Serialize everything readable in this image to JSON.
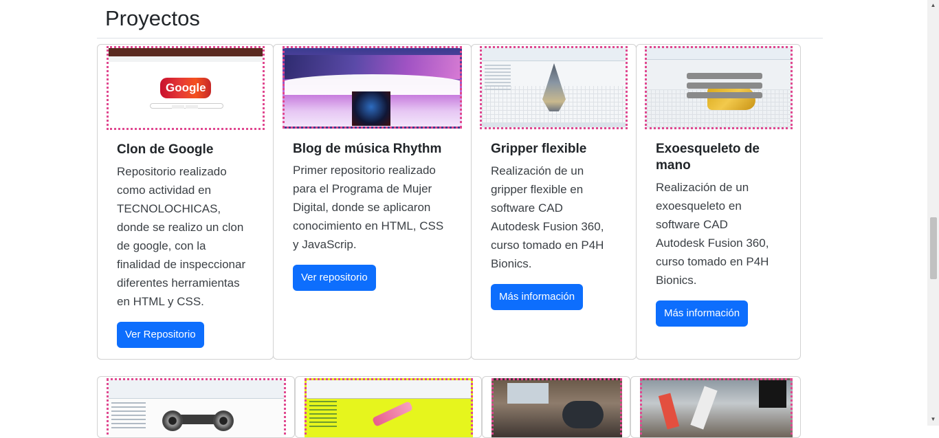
{
  "section": {
    "title": "Proyectos"
  },
  "cards": [
    {
      "title": "Clon de Google",
      "text": [
        "Repositorio realizado",
        "como actividad en",
        "TECNOLOCHICAS,",
        "donde se realizo un clon",
        "de google, con la",
        "finalidad de inspeccionar",
        "diferentes herramientas",
        "en HTML y CSS."
      ],
      "button": "Ver Repositorio",
      "thumb_text": "Google"
    },
    {
      "title": "Blog de música Rhythm",
      "text": [
        "Primer repositorio realizado",
        "para el Programa de Mujer",
        "Digital, donde se aplicaron",
        "conocimiento en HTML, CSS",
        "y JavaScrip."
      ],
      "button": "Ver repositorio"
    },
    {
      "title": "Gripper flexible",
      "text": [
        "Realización de un",
        "gripper flexible en",
        "software CAD",
        "Autodesk Fusion 360,",
        "curso tomado en P4H",
        "Bionics."
      ],
      "button": "Más información"
    },
    {
      "title": [
        "Exoesqueleto de",
        "mano"
      ],
      "text": [
        "Realización de un",
        "exoesqueleto en",
        "software CAD",
        "Autodesk Fusion 360,",
        "curso tomado en P4H",
        "Bionics."
      ],
      "button": "Más información"
    }
  ],
  "colors": {
    "primary": "#0d6efd",
    "thumb_border": "#e0478f",
    "card_border": "#d3d6d9"
  },
  "scrollbar": {
    "up": "▲",
    "down": "▼"
  }
}
